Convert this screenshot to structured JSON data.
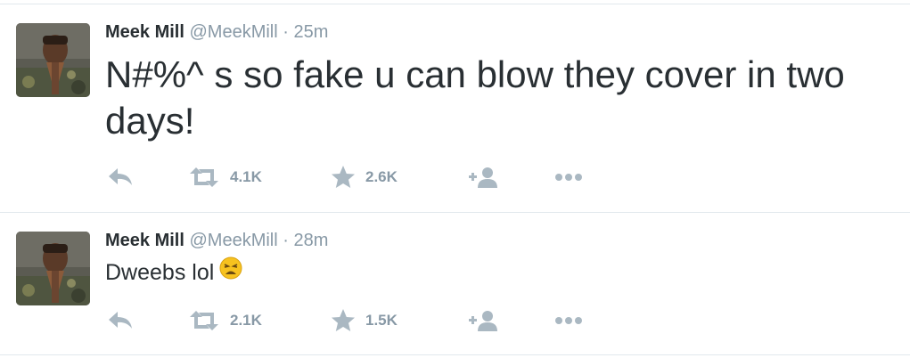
{
  "tweets": [
    {
      "name": "Meek Mill",
      "handle": "@MeekMill",
      "separator": "·",
      "time": "25m",
      "text": "N#%^ s so fake u can blow they cover in two days!",
      "retweets": "4.1K",
      "favorites": "2.6K"
    },
    {
      "name": "Meek Mill",
      "handle": "@MeekMill",
      "separator": "·",
      "time": "28m",
      "text": "Dweebs lol",
      "emoji": "weary-face-emoji",
      "retweets": "2.1K",
      "favorites": "1.5K"
    }
  ],
  "colors": {
    "action_icon": "#aab8c2",
    "meta_text": "#8899a6",
    "body_text": "#292f33",
    "divider": "#e1e8ed"
  },
  "icons": [
    "reply-icon",
    "retweet-icon",
    "favorite-icon",
    "follow-icon",
    "more-icon"
  ]
}
